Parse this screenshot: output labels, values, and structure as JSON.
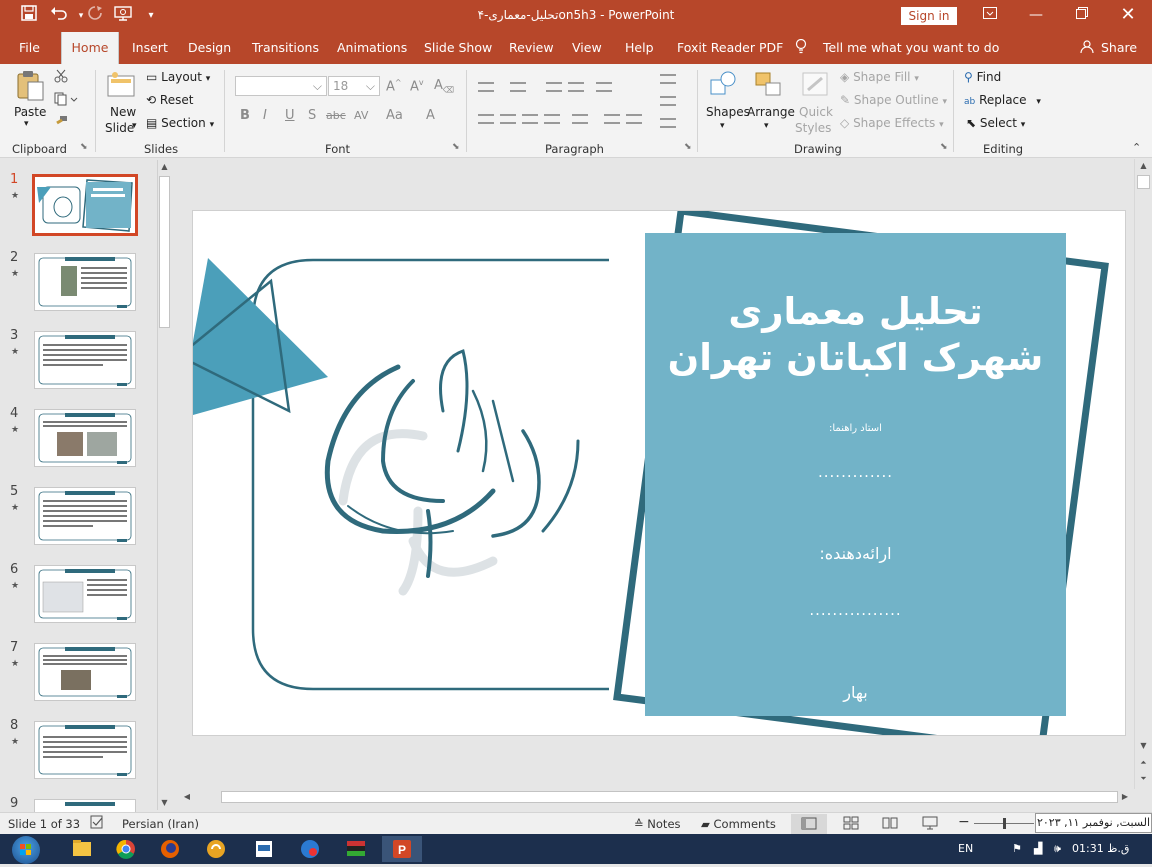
{
  "window": {
    "title": "تحلیل-معماری-۴on5h3  -  PowerPoint",
    "sign_in": "Sign in"
  },
  "tabs": [
    "File",
    "Home",
    "Insert",
    "Design",
    "Transitions",
    "Animations",
    "Slide Show",
    "Review",
    "View",
    "Help",
    "Foxit Reader PDF"
  ],
  "active_tab": "Home",
  "tell_me": "Tell me what you want to do",
  "share": "Share",
  "ribbon": {
    "clipboard": {
      "label": "Clipboard",
      "paste": "Paste"
    },
    "slides": {
      "label": "Slides",
      "new_slide_1": "New",
      "new_slide_2": "Slide",
      "layout": "Layout",
      "reset": "Reset",
      "section": "Section"
    },
    "font": {
      "label": "Font",
      "font_size": "18"
    },
    "paragraph": {
      "label": "Paragraph"
    },
    "drawing": {
      "label": "Drawing",
      "shapes": "Shapes",
      "arrange": "Arrange",
      "quick_styles_1": "Quick",
      "quick_styles_2": "Styles",
      "shape_fill": "Shape Fill",
      "shape_outline": "Shape Outline",
      "shape_effects": "Shape Effects"
    },
    "editing": {
      "label": "Editing",
      "find": "Find",
      "replace": "Replace",
      "select": "Select"
    }
  },
  "thumbnails": [
    "1",
    "2",
    "3",
    "4",
    "5",
    "6",
    "7",
    "8",
    "9"
  ],
  "slide": {
    "title_line1": "تحلیل معماری",
    "title_line2": "شهرک اکباتان تهران",
    "advisor_label": "استاد راهنما:",
    "advisor_value": ".............",
    "presenter_label": "ارائه‌دهنده:",
    "presenter_value": "................",
    "season": "بهار",
    "colors": {
      "teal_fill": "#72b3c8",
      "dark_teal": "#2f6a7c",
      "triangle": "#4b9fba"
    }
  },
  "status": {
    "slide_counter": "Slide 1 of 33",
    "language": "Persian (Iran)",
    "notes": "Notes",
    "comments": "Comments",
    "date_tooltip": "السبت, نوفمبر ۱۱, ۲۰۲۳"
  },
  "taskbar": {
    "lang": "EN",
    "time": "01:31 ق.ظ"
  },
  "accent_color": "#b7472a"
}
